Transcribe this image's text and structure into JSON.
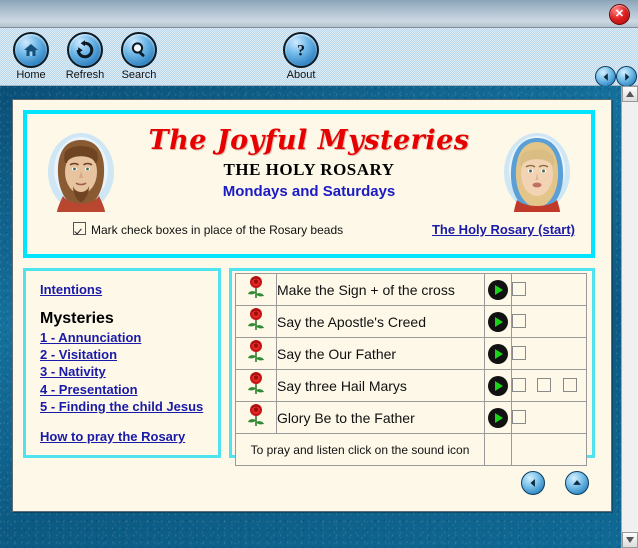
{
  "window": {
    "close_label": "✕"
  },
  "toolbar": {
    "buttons": [
      {
        "label": "Home",
        "icon": "home-icon"
      },
      {
        "label": "Refresh",
        "icon": "refresh-icon"
      },
      {
        "label": "Search",
        "icon": "search-icon"
      },
      {
        "label": "About",
        "icon": "question-icon"
      }
    ],
    "nav_back": "back-arrow-icon",
    "nav_forward": "forward-arrow-icon"
  },
  "banner": {
    "title_script": "The Joyful Mysteries",
    "title_serif": "THE HOLY ROSARY",
    "title_days": "Mondays and Saturdays",
    "portrait_left": "jesus-portrait",
    "portrait_right": "mary-portrait",
    "checkbox_label": "Mark check boxes in place of the Rosary beads",
    "checkbox_checked": true,
    "start_link": "The Holy Rosary (start)"
  },
  "sidebar": {
    "intentions_link": "Intentions",
    "mysteries_heading": "Mysteries",
    "mysteries": [
      "1 - Annunciation",
      "2 - Visitation",
      "3 - Nativity",
      "4 - Presentation",
      "5 - Finding the child Jesus"
    ],
    "how_to_link": "How to pray the Rosary"
  },
  "prayers": {
    "rows": [
      {
        "text": "Make the Sign + of the cross",
        "beads": 1
      },
      {
        "text": "Say the Apostle's Creed",
        "beads": 1
      },
      {
        "text": "Say the Our Father",
        "beads": 1
      },
      {
        "text": "Say three Hail Marys",
        "beads": 3
      },
      {
        "text": "Glory Be to the Father",
        "beads": 1
      }
    ],
    "note": "To pray and listen click on the sound icon",
    "rose_icon": "rose-icon",
    "play_icon": "play-sound-icon"
  },
  "sheet_nav": {
    "back": "back-arrow-icon",
    "up": "up-arrow-icon"
  },
  "colors": {
    "accent_cyan": "#00e5ff",
    "link_blue": "#1a1aa8",
    "title_red": "#e60000",
    "page_bg": "#0e628c",
    "sheet_bg": "#fdf8e8"
  }
}
